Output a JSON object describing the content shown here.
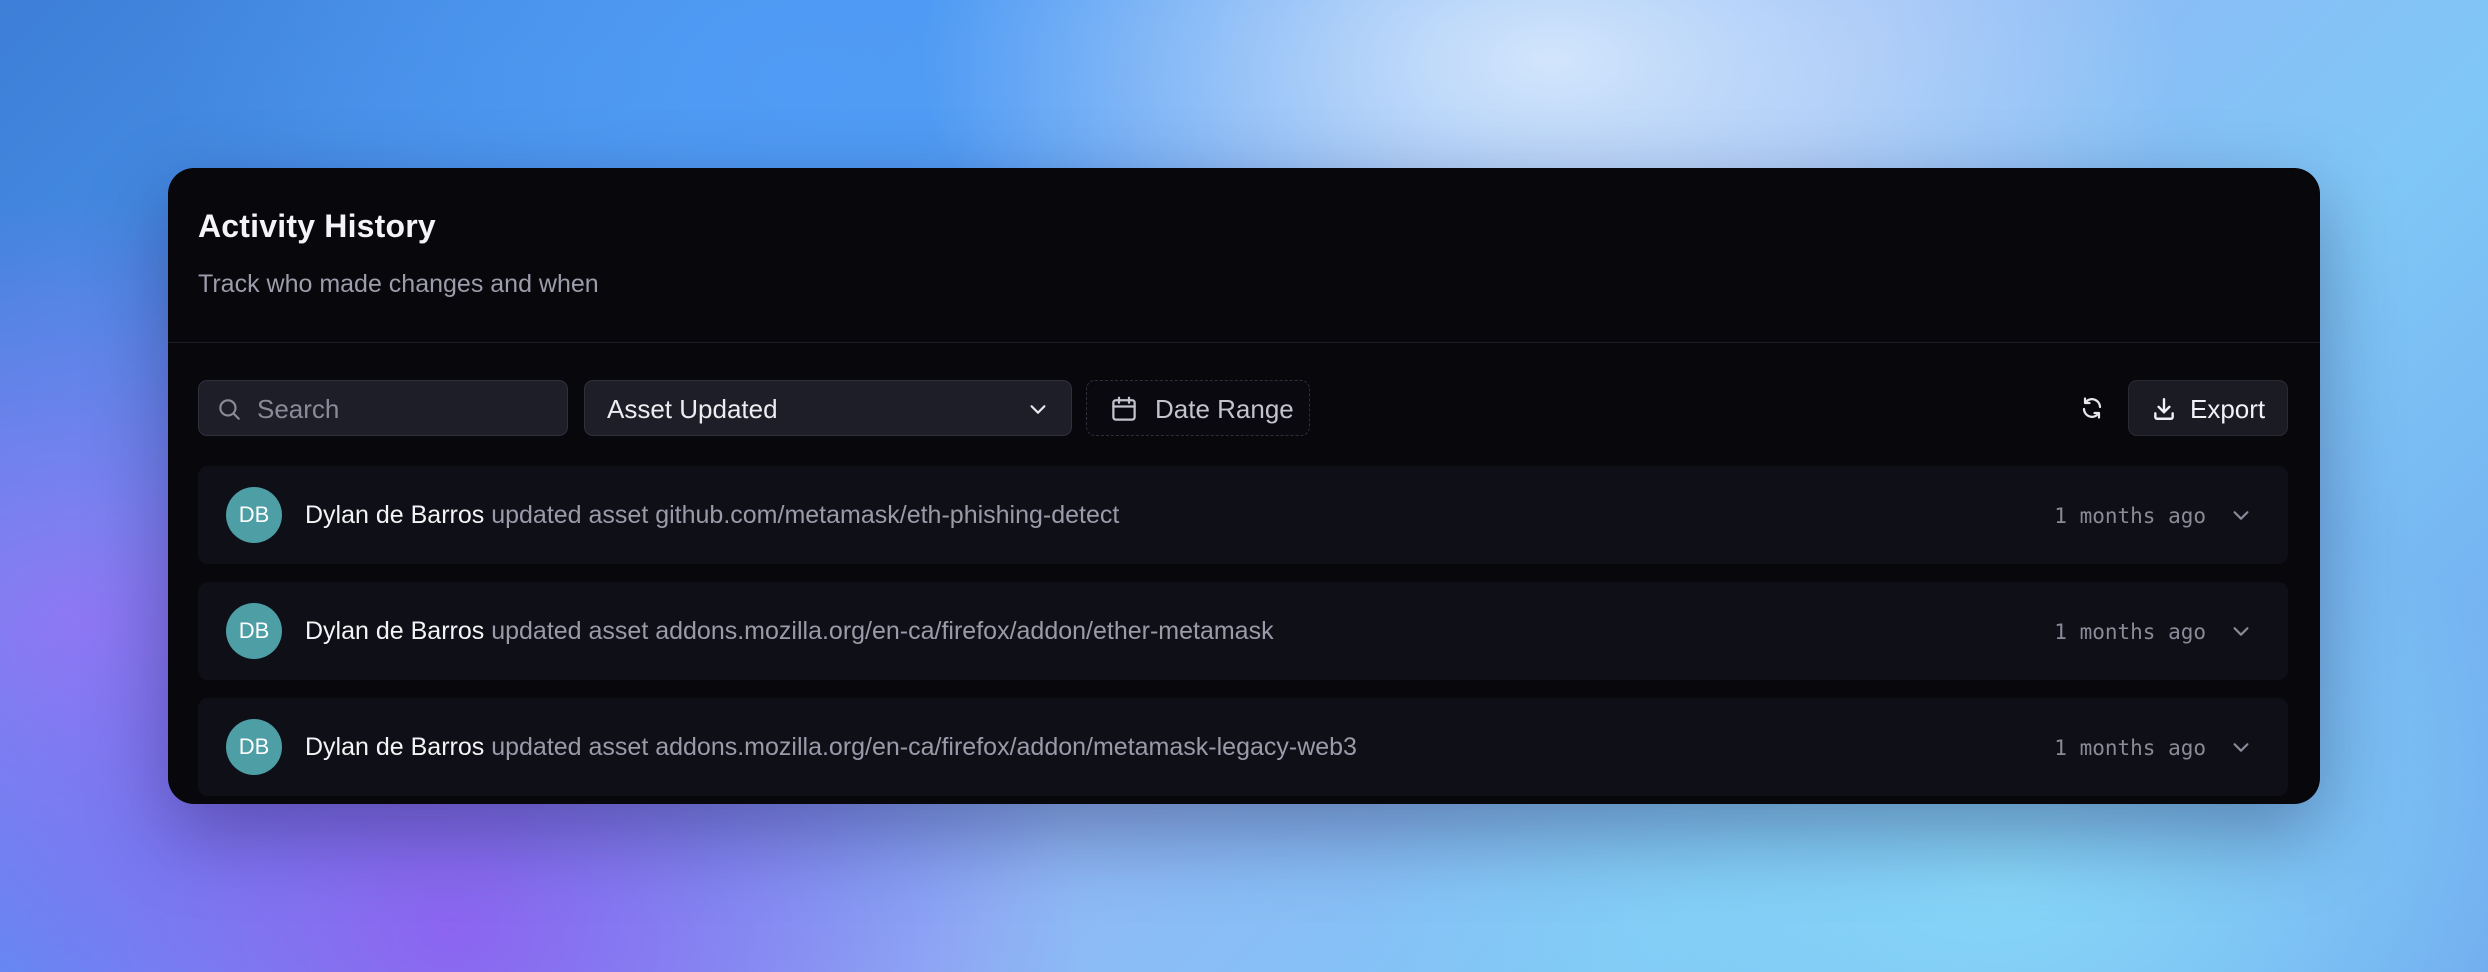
{
  "panel": {
    "title": "Activity History",
    "subtitle": "Track who made changes and when"
  },
  "toolbar": {
    "search_placeholder": "Search",
    "search_value": "",
    "event_filter": "Asset Updated",
    "date_range_label": "Date Range",
    "export_label": "Export"
  },
  "activities": [
    {
      "initials": "DB",
      "user": "Dylan de Barros",
      "action": "updated asset github.com/metamask/eth-phishing-detect",
      "time": "1 months ago"
    },
    {
      "initials": "DB",
      "user": "Dylan de Barros",
      "action": "updated asset addons.mozilla.org/en-ca/firefox/addon/ether-metamask",
      "time": "1 months ago"
    },
    {
      "initials": "DB",
      "user": "Dylan de Barros",
      "action": "updated asset addons.mozilla.org/en-ca/firefox/addon/metamask-legacy-web3",
      "time": "1 months ago"
    }
  ],
  "colors": {
    "card_background": "#07070c",
    "avatar": "#4d9ea5",
    "row_background": "#0f0f17"
  },
  "icons": {
    "search": "search-icon",
    "dropdown": "chevron-down-icon",
    "date": "calendar-icon",
    "refresh": "refresh-icon",
    "export": "download-icon",
    "row_expand": "chevron-down-icon"
  }
}
